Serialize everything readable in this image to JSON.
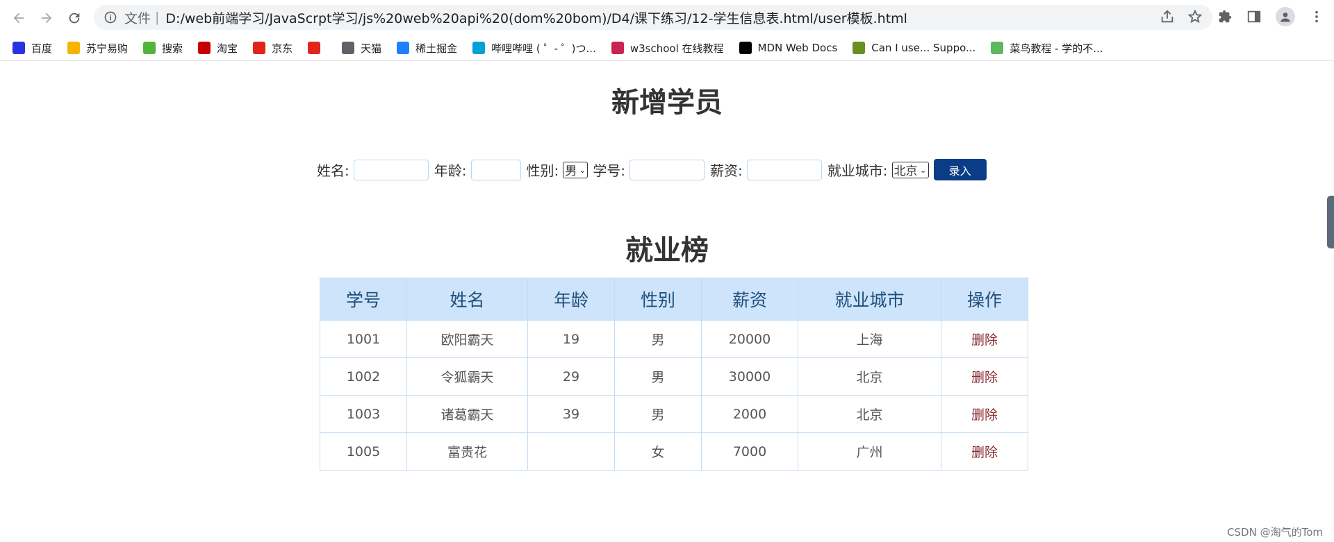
{
  "browser": {
    "file_label": "文件",
    "url": "D:/web前端学习/JavaScrpt学习/js%20web%20api%20(dom%20bom)/D4/课下练习/12-学生信息表.html/user模板.html",
    "bookmarks": [
      {
        "label": "百度",
        "color": "#2932e1"
      },
      {
        "label": "苏宁易购",
        "color": "#f5b400"
      },
      {
        "label": "搜索",
        "color": "#52b43a"
      },
      {
        "label": "淘宝",
        "color": "#c40000"
      },
      {
        "label": "京东",
        "color": "#e1251b"
      },
      {
        "label": "",
        "color": "#e1251b"
      },
      {
        "label": "天猫",
        "color": "#5f6368"
      },
      {
        "label": "稀土掘金",
        "color": "#1e80ff"
      },
      {
        "label": "哔哩哔哩 ( ゜- ゜)つ...",
        "color": "#00a1d6"
      },
      {
        "label": "w3school 在线教程",
        "color": "#c7254e"
      },
      {
        "label": "MDN Web Docs",
        "color": "#000000"
      },
      {
        "label": "Can I use... Suppo...",
        "color": "#6b8e23"
      },
      {
        "label": "菜鸟教程 - 学的不...",
        "color": "#5cb85c"
      }
    ]
  },
  "page": {
    "add_title": "新增学员",
    "list_title": "就业榜",
    "form": {
      "name_label": "姓名:",
      "age_label": "年龄:",
      "gender_label": "性别:",
      "gender_value": "男",
      "id_label": "学号:",
      "salary_label": "薪资:",
      "city_label": "就业城市:",
      "city_value": "北京",
      "submit_label": "录入"
    },
    "table": {
      "headers": [
        "学号",
        "姓名",
        "年龄",
        "性别",
        "薪资",
        "就业城市",
        "操作"
      ],
      "rows": [
        {
          "id": "1001",
          "name": "欧阳霸天",
          "age": "19",
          "gender": "男",
          "salary": "20000",
          "city": "上海",
          "action": "删除"
        },
        {
          "id": "1002",
          "name": "令狐霸天",
          "age": "29",
          "gender": "男",
          "salary": "30000",
          "city": "北京",
          "action": "删除"
        },
        {
          "id": "1003",
          "name": "诸葛霸天",
          "age": "39",
          "gender": "男",
          "salary": "2000",
          "city": "北京",
          "action": "删除"
        },
        {
          "id": "1005",
          "name": "富贵花",
          "age": "",
          "gender": "女",
          "salary": "7000",
          "city": "广州",
          "action": "删除"
        }
      ]
    }
  },
  "watermark": "CSDN @淘气的Tom"
}
